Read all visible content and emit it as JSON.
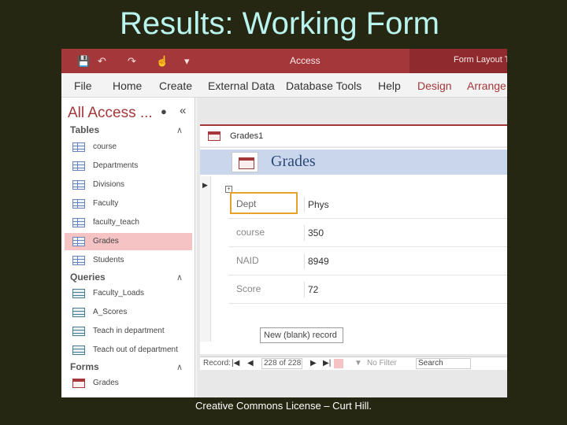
{
  "slide": {
    "title": "Results: Working Form",
    "footer": "Creative Commons License – Curt Hill."
  },
  "titlebar": {
    "app_title": "Access",
    "context_title": "Form Layout T",
    "qat": [
      "save-icon",
      "undo-icon",
      "redo-icon",
      "touch-mode-icon",
      "customize-icon"
    ]
  },
  "ribbon": {
    "tabs": [
      "File",
      "Home",
      "Create",
      "External Data",
      "Database Tools",
      "Help",
      "Design",
      "Arrange"
    ]
  },
  "nav": {
    "header": "All Access ...",
    "groups": [
      {
        "label": "Tables",
        "items": [
          "course",
          "Departments",
          "Divisions",
          "Faculty",
          "faculty_teach",
          "Grades",
          "Students"
        ]
      },
      {
        "label": "Queries",
        "items": [
          "Faculty_Loads",
          "A_Scores",
          "Teach in department",
          "Teach out of department"
        ]
      },
      {
        "label": "Forms",
        "items": [
          "Grades"
        ]
      }
    ],
    "selected": "Grades"
  },
  "document": {
    "tab_label": "Grades1",
    "form_title": "Grades",
    "fields": [
      {
        "label": "Dept",
        "value": "Phys"
      },
      {
        "label": "course",
        "value": "350"
      },
      {
        "label": "NAID",
        "value": "8949"
      },
      {
        "label": "Score",
        "value": "72"
      }
    ]
  },
  "record_nav": {
    "label": "Record:",
    "current": "228 of 228",
    "filter": "No Filter",
    "search": "Search"
  },
  "tooltip": "New (blank) record",
  "colors": {
    "accent": "#a4373a",
    "slide_bg": "#262712",
    "title": "#b9f5ee"
  }
}
